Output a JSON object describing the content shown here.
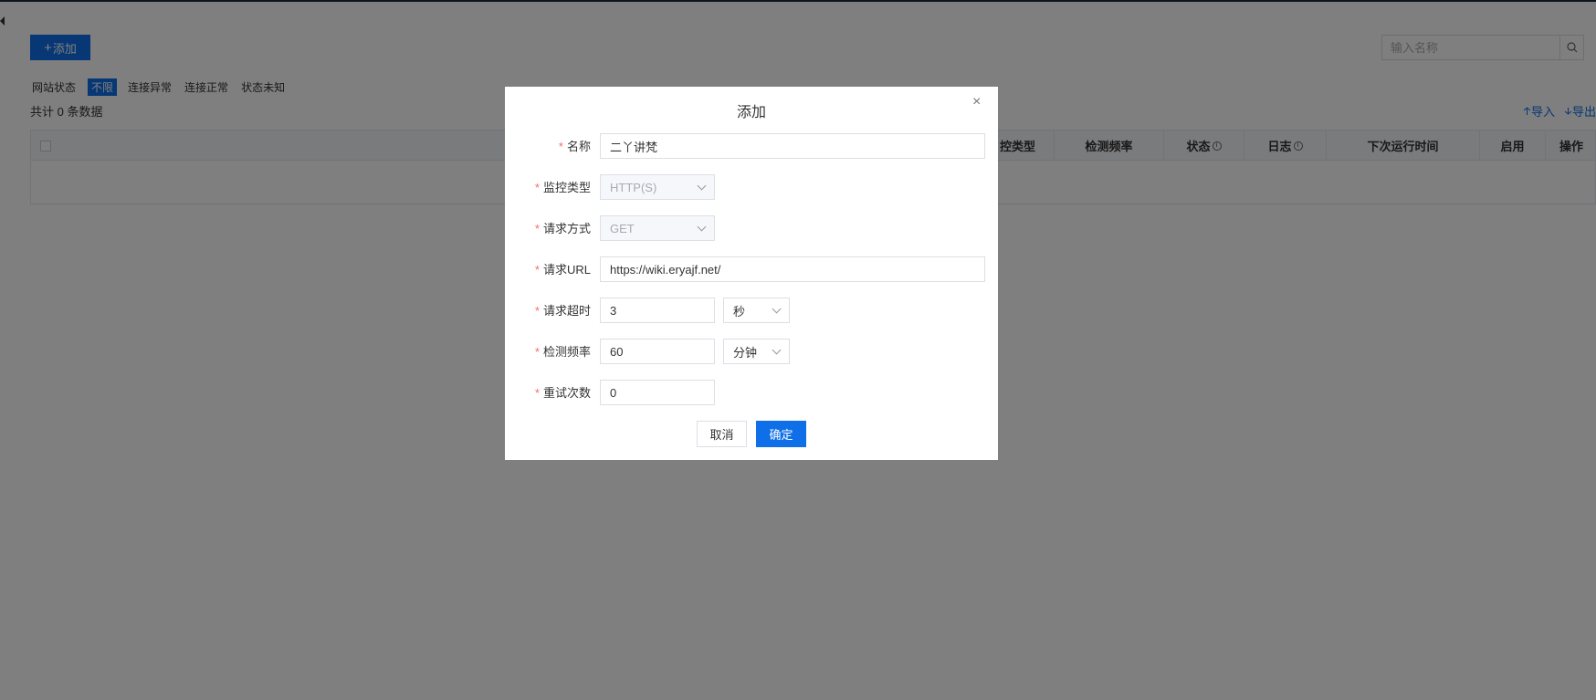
{
  "toolbar": {
    "add_label": "添加",
    "add_plus": "+",
    "import_label": "导入",
    "export_label": "导出"
  },
  "search": {
    "placeholder": "输入名称"
  },
  "filter": {
    "label": "网站状态",
    "options": [
      "不限",
      "连接异常",
      "连接正常",
      "状态未知"
    ],
    "active": "不限"
  },
  "total": "共计 0 条数据",
  "table": {
    "headers": [
      "控类型",
      "检测频率",
      "状态",
      "日志",
      "下次运行时间",
      "启用",
      "操作"
    ],
    "info_icon": "i"
  },
  "modal": {
    "title": "添加",
    "fields": {
      "name": {
        "label": "名称",
        "value": "二丫讲梵"
      },
      "monitor_type": {
        "label": "监控类型",
        "value": "HTTP(S)"
      },
      "method": {
        "label": "请求方式",
        "value": "GET"
      },
      "url": {
        "label": "请求URL",
        "value": "https://wiki.eryajf.net/"
      },
      "timeout": {
        "label": "请求超时",
        "value": "3",
        "unit": "秒"
      },
      "frequency": {
        "label": "检测频率",
        "value": "60",
        "unit": "分钟"
      },
      "retry": {
        "label": "重试次数",
        "value": "0"
      }
    },
    "required_mark": "*",
    "cancel_label": "取消",
    "ok_label": "确定",
    "close_glyph": "×"
  },
  "colors": {
    "primary": "#0f6fe8",
    "required": "#f56c6c",
    "overlay": "rgba(0,0,0,0.5)"
  }
}
